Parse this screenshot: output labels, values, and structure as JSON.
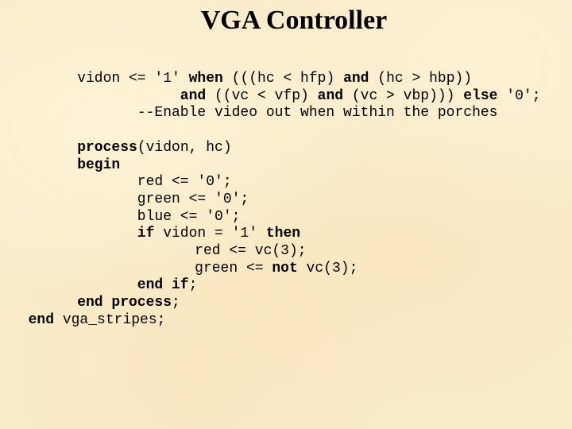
{
  "slide": {
    "title": "VGA Controller",
    "code_lines": [
      {
        "indent": 9,
        "tokens": [
          {
            "t": "vidon <= '1' ",
            "b": false
          },
          {
            "t": "when",
            "b": true
          },
          {
            "t": " (((hc < hfp) ",
            "b": false
          },
          {
            "t": "and",
            "b": true
          },
          {
            "t": " (hc > hbp))",
            "b": false
          }
        ]
      },
      {
        "indent": 21,
        "tokens": [
          {
            "t": "and",
            "b": true
          },
          {
            "t": " ((vc < vfp) ",
            "b": false
          },
          {
            "t": "and",
            "b": true
          },
          {
            "t": " (vc > vbp))) ",
            "b": false
          },
          {
            "t": "else",
            "b": true
          },
          {
            "t": " '0';",
            "b": false
          }
        ]
      },
      {
        "indent": 16,
        "tokens": [
          {
            "t": "--Enable video out when within the porches",
            "b": false
          }
        ]
      },
      {
        "indent": 9,
        "tokens": []
      },
      {
        "indent": 9,
        "tokens": [
          {
            "t": "process",
            "b": true
          },
          {
            "t": "(vidon, hc)",
            "b": false
          }
        ]
      },
      {
        "indent": 9,
        "tokens": [
          {
            "t": "begin",
            "b": true
          }
        ]
      },
      {
        "indent": 16,
        "tokens": [
          {
            "t": "red <= '0';",
            "b": false
          }
        ]
      },
      {
        "indent": 16,
        "tokens": [
          {
            "t": "green <= '0';",
            "b": false
          }
        ]
      },
      {
        "indent": 16,
        "tokens": [
          {
            "t": "blue <= '0';",
            "b": false
          }
        ]
      },
      {
        "indent": 16,
        "tokens": [
          {
            "t": "if",
            "b": true
          },
          {
            "t": " vidon = '1' ",
            "b": false
          },
          {
            "t": "then",
            "b": true
          }
        ]
      },
      {
        "indent": 22.7,
        "tokens": [
          {
            "t": "red <= vc(3);",
            "b": false
          }
        ]
      },
      {
        "indent": 22.7,
        "tokens": [
          {
            "t": "green <= ",
            "b": false
          },
          {
            "t": "not",
            "b": true
          },
          {
            "t": " vc(3);",
            "b": false
          }
        ]
      },
      {
        "indent": 16,
        "tokens": [
          {
            "t": "end if",
            "b": true
          },
          {
            "t": ";",
            "b": false
          }
        ]
      },
      {
        "indent": 9,
        "tokens": [
          {
            "t": "end process",
            "b": true
          },
          {
            "t": ";",
            "b": false
          }
        ]
      },
      {
        "indent": 3.3,
        "tokens": [
          {
            "t": "end",
            "b": true
          },
          {
            "t": " vga_stripes;",
            "b": false
          }
        ]
      }
    ]
  }
}
